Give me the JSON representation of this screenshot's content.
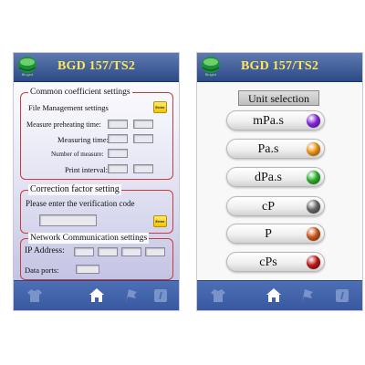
{
  "app_title": "BGD 157/TS2",
  "logo_text": "Biuged",
  "left_screen": {
    "common": {
      "legend": "Common coefficient settings",
      "file_management_label": "File Management settings",
      "enter_label": "Enter",
      "measure_preheating_label": "Measure preheating time:",
      "measuring_time_label": "Measuring time:",
      "number_of_measure_label": "Number of measure:",
      "print_interval_label": "Print interval:"
    },
    "correction": {
      "legend": "Correction factor setting",
      "prompt": "Please enter the verification code",
      "enter_label": "Enter"
    },
    "network": {
      "legend": "Network Communication settings",
      "ip_label": "IP Address:",
      "port_label": "Data ports:"
    }
  },
  "right_screen": {
    "header": "Unit selection",
    "units": [
      {
        "label": "mPa.s",
        "dot_color": "#8a2be2"
      },
      {
        "label": "Pa.s",
        "dot_color": "#f39a1a"
      },
      {
        "label": "dPa.s",
        "dot_color": "#2fb52f"
      },
      {
        "label": "cP",
        "dot_color": "#6b6b6b"
      },
      {
        "label": "P",
        "dot_color": "#d2581e"
      },
      {
        "label": "cPs",
        "dot_color": "#c41818"
      }
    ]
  },
  "bottom_nav": [
    "shirt-icon",
    "home-icon",
    "flag-icon",
    "info-icon"
  ],
  "colors": {
    "topbar": "#2c4a86",
    "title": "#ffe65a",
    "group_border": "#cc3b3b",
    "enter_button": "#f2c400",
    "bottombar": "#3859a0"
  }
}
